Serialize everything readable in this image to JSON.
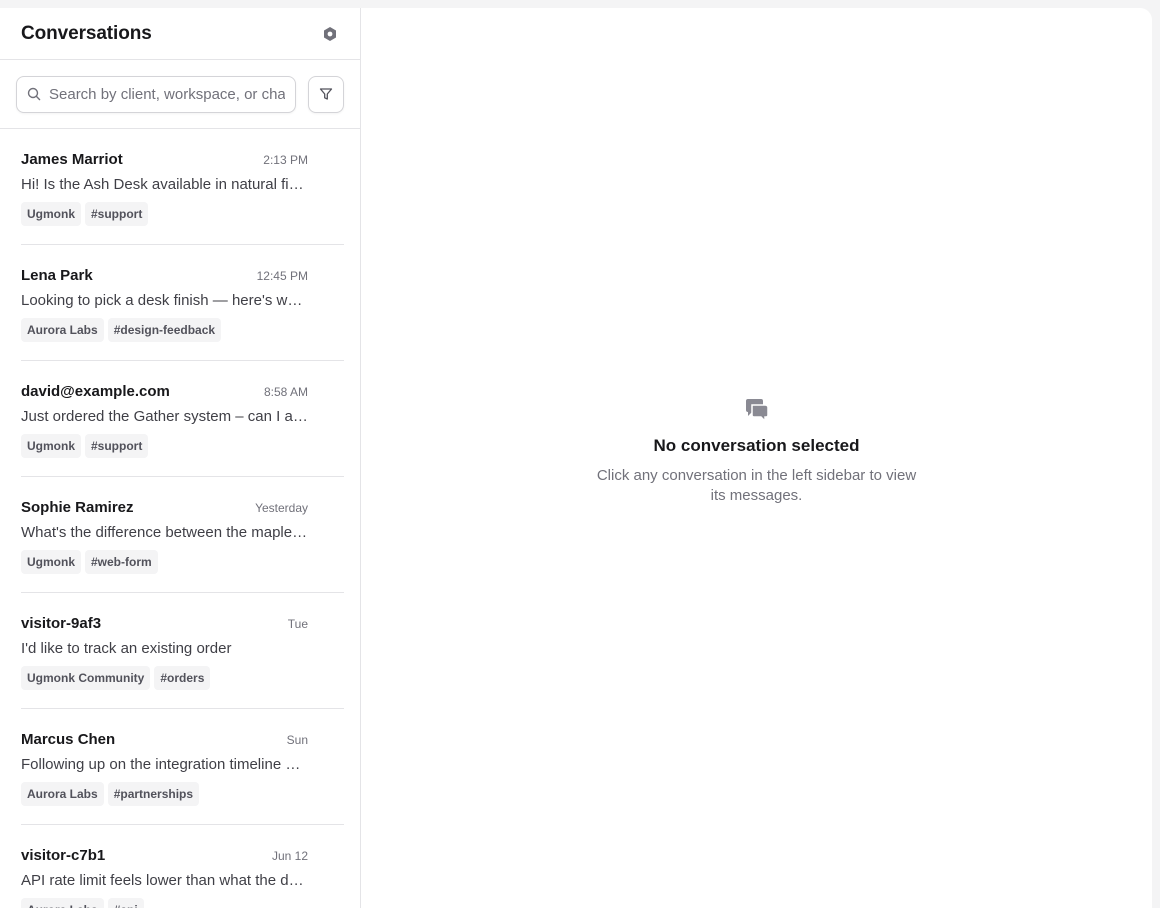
{
  "sidebar": {
    "title": "Conversations",
    "search": {
      "placeholder": "Search by client, workspace, or channel",
      "value": ""
    },
    "conversations": [
      {
        "name": "James Marriot",
        "time": "2:13 PM",
        "preview": "Hi! Is the Ash Desk available in natural finish?",
        "tags": [
          "Ugmonk",
          "#support"
        ]
      },
      {
        "name": "Lena Park",
        "time": "12:45 PM",
        "preview": "Looking to pick a desk finish — here's what I'm thinking",
        "tags": [
          "Aurora Labs",
          "#design-feedback"
        ]
      },
      {
        "name": "david@example.com",
        "time": "8:58 AM",
        "preview": "Just ordered the Gather system – can I add a shelf?",
        "tags": [
          "Ugmonk",
          "#support"
        ]
      },
      {
        "name": "Sophie Ramirez",
        "time": "Yesterday",
        "preview": "What's the difference between the maple and walnut?",
        "tags": [
          "Ugmonk",
          "#web-form"
        ]
      },
      {
        "name": "visitor-9af3",
        "time": "Tue",
        "preview": "I'd like to track an existing order",
        "tags": [
          "Ugmonk Community",
          "#orders"
        ]
      },
      {
        "name": "Marcus Chen",
        "time": "Sun",
        "preview": "Following up on the integration timeline we discussed",
        "tags": [
          "Aurora Labs",
          "#partnerships"
        ]
      },
      {
        "name": "visitor-c7b1",
        "time": "Jun 12",
        "preview": "API rate limit feels lower than what the docs say",
        "tags": [
          "Aurora Labs",
          "#api"
        ]
      }
    ]
  },
  "main": {
    "empty_title": "No conversation selected",
    "empty_description": "Click any conversation in the left sidebar to view its messages."
  },
  "colors": {
    "accent": "#18181b",
    "muted": "#71717a",
    "border": "#e4e4e7",
    "tag_bg": "#f4f4f5"
  },
  "icons": {
    "settings": "gear-icon",
    "search": "search-icon",
    "filter": "filter-icon",
    "empty": "chat-bubbles-icon"
  }
}
